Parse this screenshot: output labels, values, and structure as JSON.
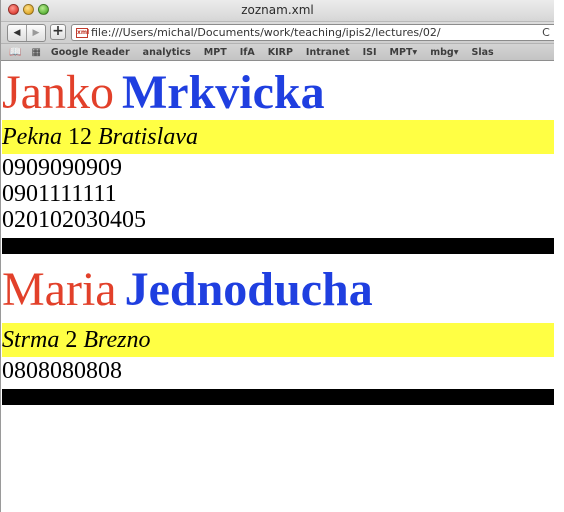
{
  "window": {
    "title": "zoznam.xml",
    "url": "file:///Users/michal/Documents/work/teaching/ipis2/lectures/02/",
    "nav_back": "◀",
    "nav_forward": "▶",
    "add_label": "+",
    "reload_icon": "C"
  },
  "bookmarks": [
    "Google Reader",
    "analytics",
    "MPT",
    "IfA",
    "KIRP",
    "Intranet",
    "ISI",
    "MPT▾",
    "mbg▾",
    "Slas"
  ],
  "persons": [
    {
      "first": "Janko",
      "last": "Mrkvicka",
      "street": "Pekna",
      "number": "12",
      "city": "Bratislava",
      "phones": [
        "0909090909",
        "0901111111",
        "020102030405"
      ]
    },
    {
      "first": "Maria",
      "last": "Jednoducha",
      "street": "Strma",
      "number": "2",
      "city": "Brezno",
      "phones": [
        "0808080808"
      ]
    }
  ]
}
